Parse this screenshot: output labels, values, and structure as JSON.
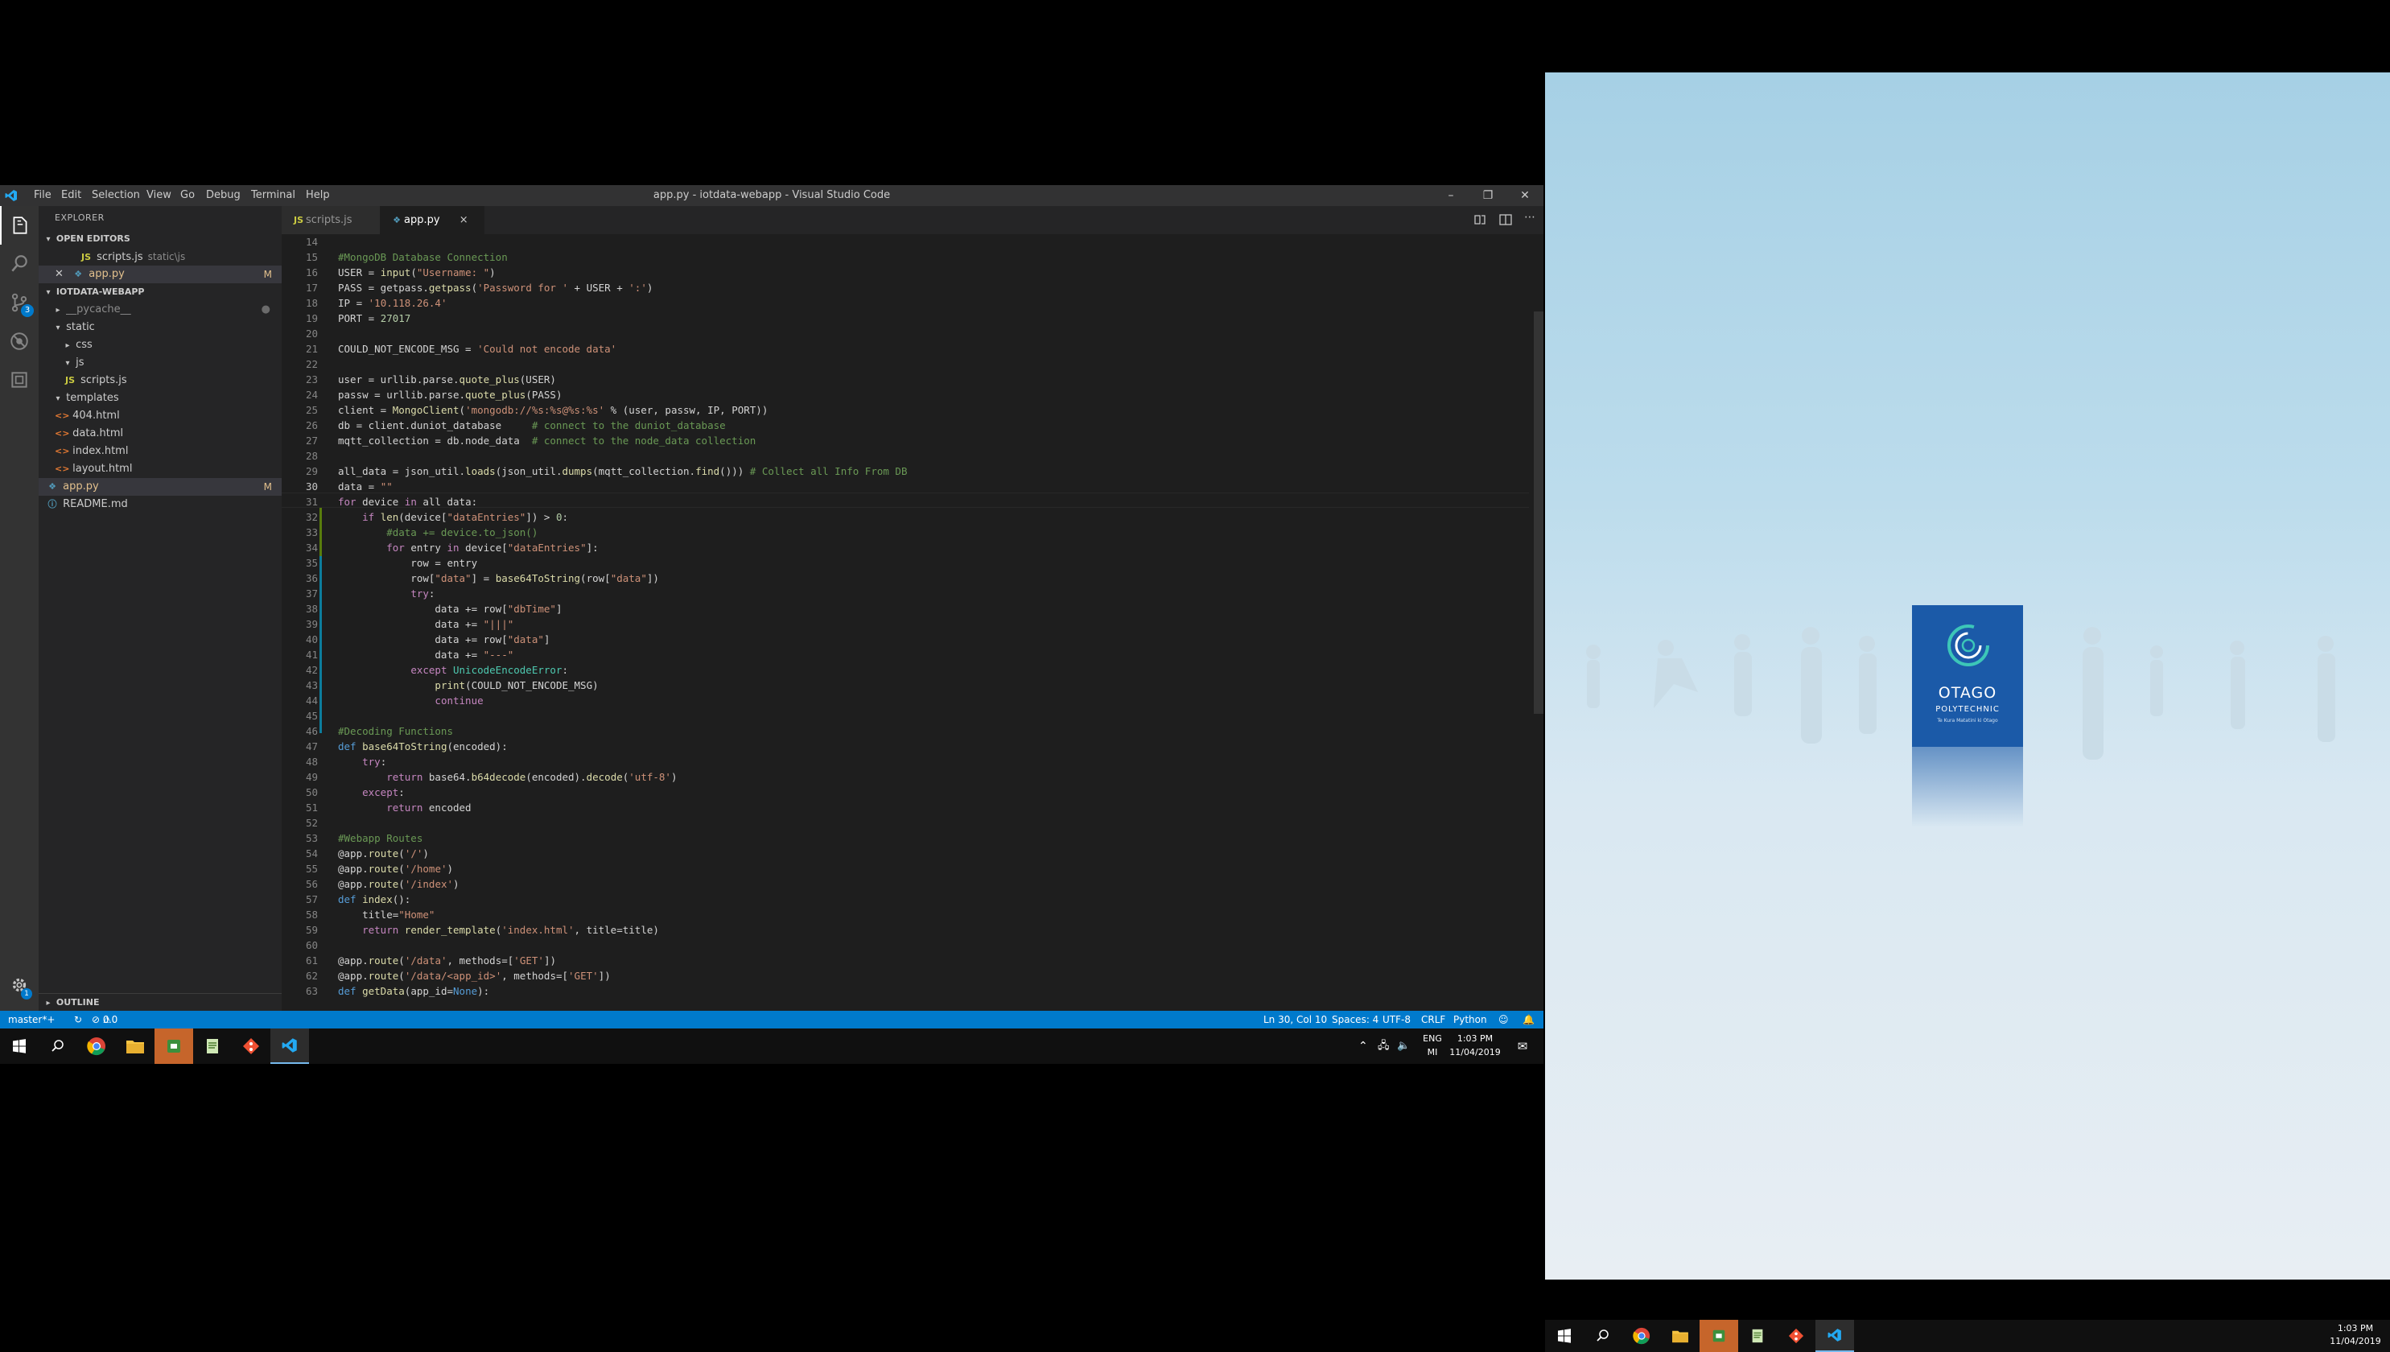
{
  "window": {
    "title": "app.py - iotdata-webapp - Visual Studio Code",
    "menu": [
      "File",
      "Edit",
      "Selection",
      "View",
      "Go",
      "Debug",
      "Terminal",
      "Help"
    ]
  },
  "activity": {
    "scm_badge": "3",
    "settings_badge": "1"
  },
  "sidebar": {
    "header": "EXPLORER",
    "open_editors_label": "OPEN EDITORS",
    "open_editors": [
      {
        "name": "scripts.js",
        "path": "static\\js",
        "lang": "JS"
      },
      {
        "name": "app.py",
        "status": "M",
        "lang": "py"
      }
    ],
    "project_label": "IOTDATA-WEBAPP",
    "tree": [
      {
        "name": "__pycache__"
      },
      {
        "name": "static"
      },
      {
        "name": "css"
      },
      {
        "name": "js"
      },
      {
        "name": "scripts.js"
      },
      {
        "name": "templates"
      },
      {
        "name": "404.html"
      },
      {
        "name": "data.html"
      },
      {
        "name": "index.html"
      },
      {
        "name": "layout.html"
      },
      {
        "name": "app.py",
        "status": "M"
      },
      {
        "name": "README.md"
      }
    ],
    "outline_label": "OUTLINE"
  },
  "tabs": [
    {
      "label": "scripts.js",
      "lang": "JS"
    },
    {
      "label": "app.py",
      "close": "×"
    }
  ],
  "editor": {
    "line_numbers": [
      "14",
      "15",
      "16",
      "17",
      "18",
      "19",
      "20",
      "21",
      "22",
      "23",
      "24",
      "25",
      "26",
      "27",
      "28",
      "29",
      "30",
      "31",
      "32",
      "33",
      "34",
      "35",
      "36",
      "37",
      "38",
      "39",
      "40",
      "41",
      "42",
      "43",
      "44",
      "45",
      "46",
      "47",
      "48",
      "49",
      "50",
      "51",
      "52",
      "53",
      "54",
      "55",
      "56",
      "57",
      "58",
      "59",
      "60",
      "61",
      "62",
      "63"
    ],
    "lines": [
      "",
      "#MongoDB Database Connection",
      "USER = input(\"Username: \")",
      "PASS = getpass.getpass('Password for ' + USER + ':')",
      "IP = '10.118.26.4'",
      "PORT = 27017",
      "",
      "COULD_NOT_ENCODE_MSG = 'Could not encode data'",
      "",
      "user = urllib.parse.quote_plus(USER)",
      "passw = urllib.parse.quote_plus(PASS)",
      "client = MongoClient('mongodb://%s:%s@%s:%s' % (user, passw, IP, PORT))",
      "db = client.duniot_database     # connect to the duniot_database",
      "mqtt_collection = db.node_data  # connect to the node_data collection",
      "",
      "all_data = json_util.loads(json_util.dumps(mqtt_collection.find())) # Collect all Info From DB",
      "data = \"\"",
      "for device in all_data:",
      "    if len(device[\"dataEntries\"]) > 0:",
      "        #data += device.to_json()",
      "        for entry in device[\"dataEntries\"]:",
      "            row = entry",
      "            row[\"data\"] = base64ToString(row[\"data\"])",
      "            try:",
      "                data += row[\"dbTime\"]",
      "                data += \"|||\"",
      "                data += row[\"data\"]",
      "                data += \"---\"",
      "            except UnicodeEncodeError:",
      "                print(COULD_NOT_ENCODE_MSG)",
      "                continue",
      "",
      "#Decoding Functions",
      "def base64ToString(encoded):",
      "    try:",
      "        return base64.b64decode(encoded).decode('utf-8')",
      "    except:",
      "        return encoded",
      "",
      "#Webapp Routes",
      "@app.route('/')",
      "@app.route('/home')",
      "@app.route('/index')",
      "def index():",
      "    title=\"Home\"",
      "    return render_template('index.html', title=title)",
      "",
      "@app.route('/data', methods=['GET'])",
      "@app.route('/data/<app_id>', methods=['GET'])",
      "def getData(app_id=None):"
    ]
  },
  "statusbar": {
    "branch": "master*+",
    "errors": "0",
    "warnings": "0",
    "position": "Ln 30, Col 10",
    "spaces": "Spaces: 4",
    "encoding": "UTF-8",
    "eol": "CRLF",
    "language": "Python"
  },
  "taskbar_left": {
    "lang1": "ENG",
    "lang2": "MI",
    "time": "1:03 PM",
    "date": "11/04/2019"
  },
  "desktop_right": {
    "logo_title": "OTAGO",
    "logo_subtitle": "POLYTECHNIC",
    "logo_tagline": "Te Kura Matatini ki Otago"
  },
  "taskbar_right": {
    "time": "1:03 PM",
    "date": "11/04/2019"
  }
}
